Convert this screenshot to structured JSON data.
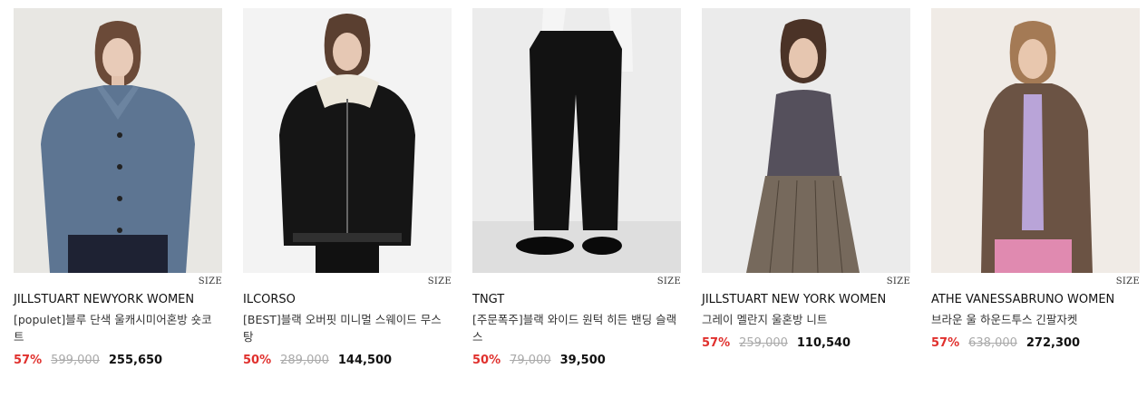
{
  "products": [
    {
      "brand": "JILLSTUART NEWYORK WOMEN",
      "name": "[populet]블루 단색 울캐시미어혼방 숏코트",
      "discount": "57%",
      "original_price": "599,000",
      "sale_price": "255,650",
      "size_label": "SIZE",
      "bg": "#e7e6e2"
    },
    {
      "brand": "ILCORSO",
      "name": "[BEST]블랙 오버핏 미니멀 스웨이드 무스탕",
      "discount": "50%",
      "original_price": "289,000",
      "sale_price": "144,500",
      "size_label": "SIZE",
      "bg": "#f3f3f3"
    },
    {
      "brand": "TNGT",
      "name": "[주문폭주]블랙 와이드 원턱 히든 밴딩 슬랙스",
      "discount": "50%",
      "original_price": "79,000",
      "sale_price": "39,500",
      "size_label": "SIZE",
      "bg": "#ececec"
    },
    {
      "brand": "JILLSTUART NEW YORK WOMEN",
      "name": "그레이 멜란지 울혼방 니트",
      "discount": "57%",
      "original_price": "259,000",
      "sale_price": "110,540",
      "size_label": "SIZE",
      "bg": "#ebebeb"
    },
    {
      "brand": "ATHE VANESSABRUNO WOMEN",
      "name": "브라운 울 하운드투스 긴팔자켓",
      "discount": "57%",
      "original_price": "638,000",
      "sale_price": "272,300",
      "size_label": "SIZE",
      "bg": "#f0ebe6"
    }
  ],
  "colors": {
    "discount": "#e0302d",
    "original": "#aaaaaa"
  }
}
